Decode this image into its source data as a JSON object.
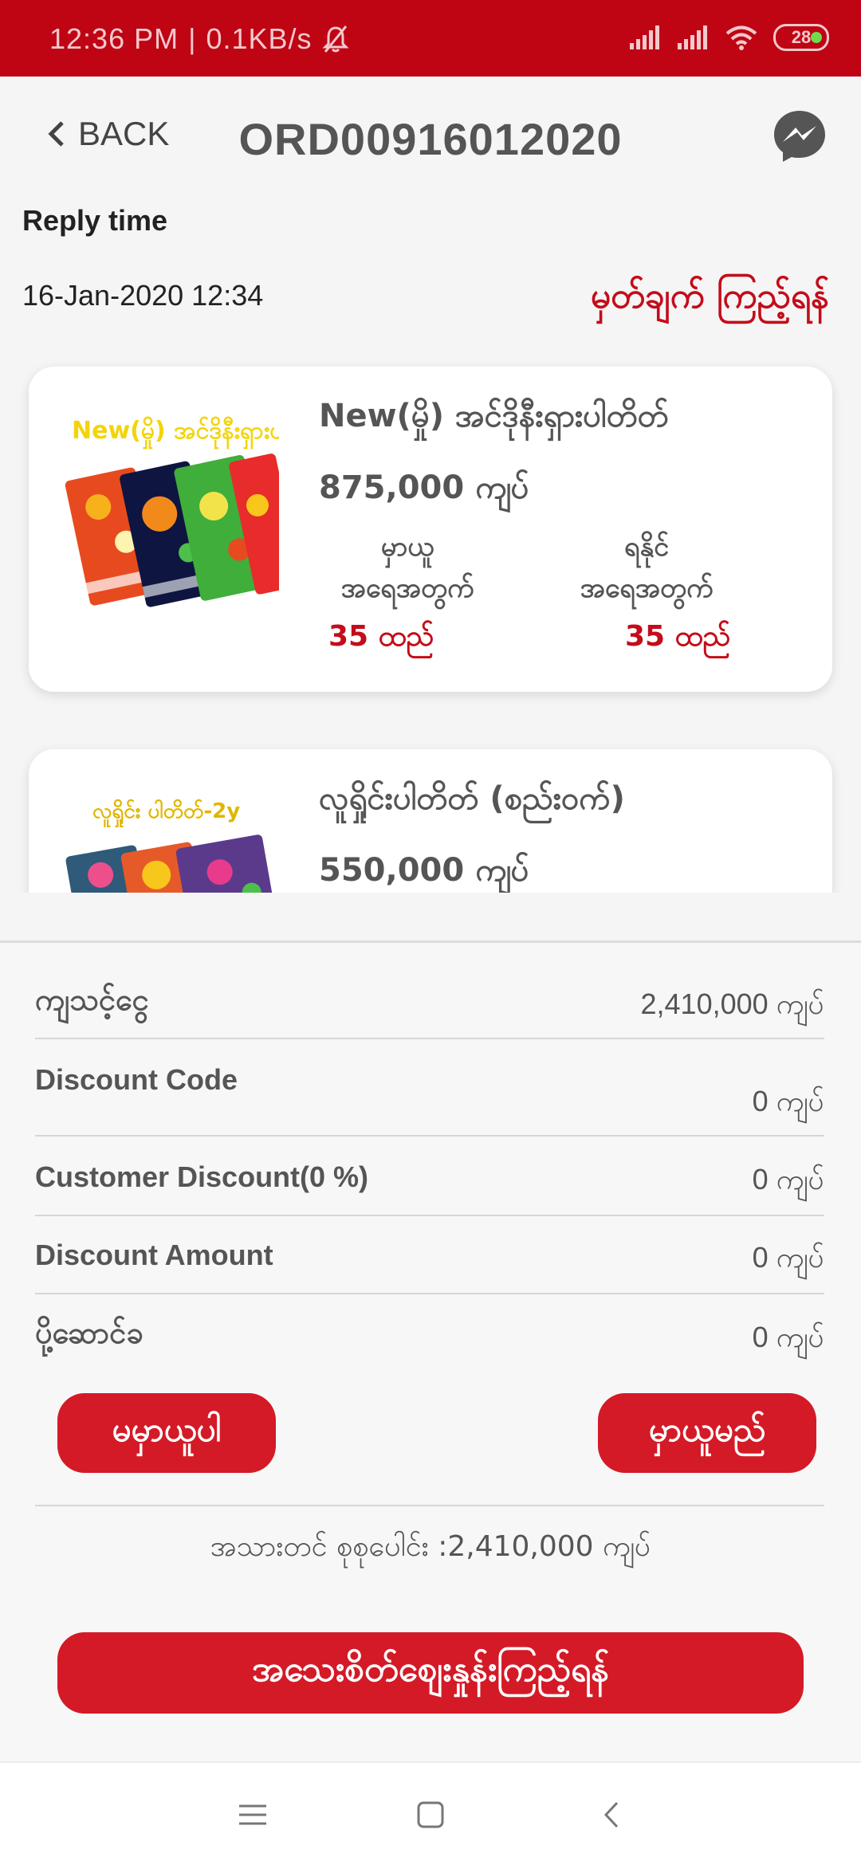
{
  "status_bar": {
    "time": "12:36 PM",
    "separator": "|",
    "speed": "0.1KB/s",
    "battery": "28"
  },
  "header": {
    "back_label": "BACK",
    "title": "ORD00916012020"
  },
  "reply": {
    "label": "Reply time",
    "datetime": "16-Jan-2020 12:34",
    "notes_link": "မှတ်ချက် ကြည့်ရန်"
  },
  "products": [
    {
      "thumb_caption": "New(မှို) အင်ဒိုနီးရှားပ",
      "name": "New(မှို) အင်ဒိုနီးရှားပါတိတ်",
      "price": "875,000 ကျပ်",
      "ordered_label_1": "မှာယူ",
      "ordered_label_2": "အရေအတွက်",
      "available_label_1": "ရနိုင်",
      "available_label_2": "အရေအတွက်",
      "ordered_qty": "35 ထည်",
      "available_qty": "35 ထည်"
    },
    {
      "thumb_caption": "လူရှိုင်း ပါတိတ်-2y",
      "name": "လူရှိုင်းပါတိတ် (စည်းဝက်)",
      "price": "550,000 ကျပ်"
    }
  ],
  "summary": {
    "rows": [
      {
        "label": "ကျသင့်ငွေ",
        "value": "2,410,000 ကျပ်"
      },
      {
        "label": "Discount Code",
        "value": "0 ကျပ်"
      },
      {
        "label": "Customer Discount(0 %)",
        "value": "0 ကျပ်"
      },
      {
        "label": "Discount Amount",
        "value": "0 ကျပ်"
      },
      {
        "label": "ပို့ဆောင်ခ",
        "value": "0 ကျပ်"
      }
    ],
    "reject_label": "မမှာယူပါ",
    "accept_label": "မှာယူမည်",
    "grand_total": "အသားတင် စုစုပေါင်း :2,410,000 ကျပ်",
    "detail_button": "အသေးစိတ်စျေးနှုန်းကြည့်ရန်"
  },
  "colors": {
    "brand_red": "#bf0414",
    "button_red": "#d41a27",
    "accent_text_red": "#c40c1a"
  },
  "icons": {
    "back": "chevron-left-icon",
    "messenger": "messenger-icon",
    "nav_menu": "menu-icon",
    "nav_home": "home-square-icon",
    "nav_back": "back-triangle-icon"
  }
}
